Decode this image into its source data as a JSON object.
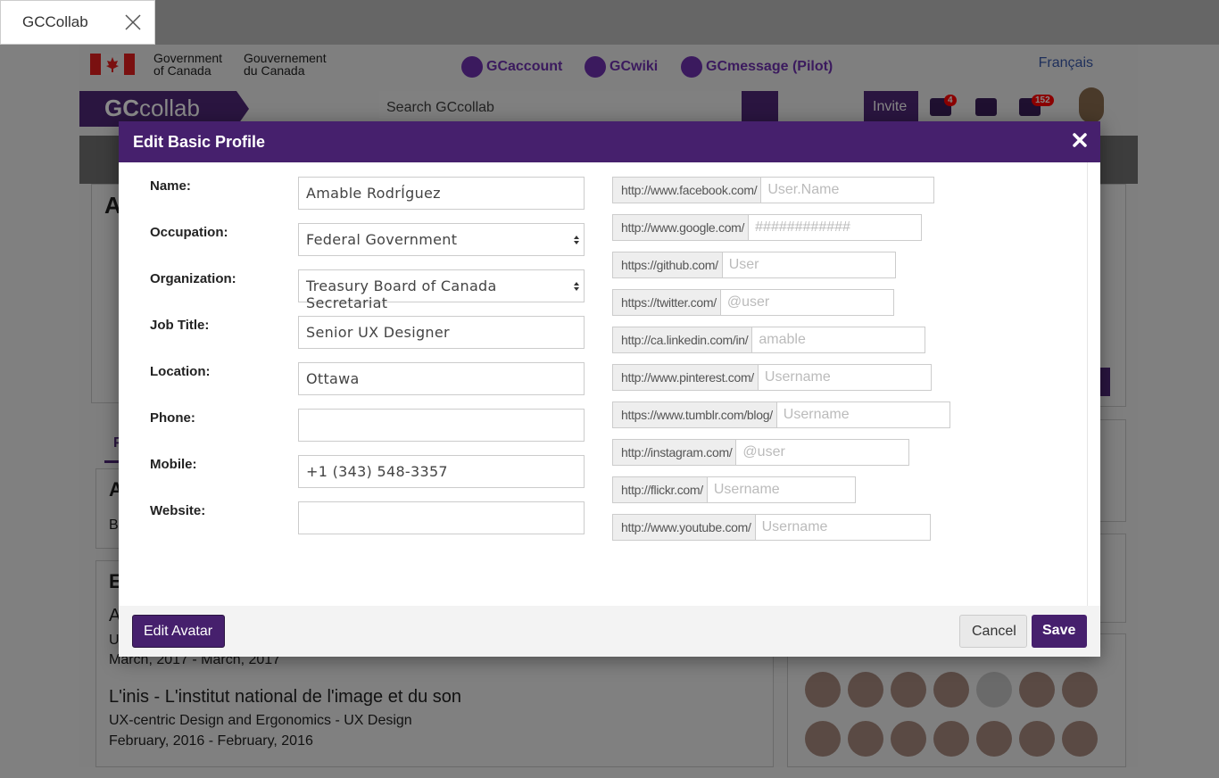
{
  "browser": {
    "tab_title": "GCCollab"
  },
  "header": {
    "gov_en_line1": "Government",
    "gov_en_line2": "of Canada",
    "gov_fr_line1": "Gouvernement",
    "gov_fr_line2": "du Canada",
    "tools": [
      "GCaccount",
      "GCwiki",
      "GCmessage (Pilot)"
    ],
    "language": "Français"
  },
  "navbar": {
    "brand_gc": "GC",
    "brand_rest": "collab",
    "search_placeholder": "Search GCcollab",
    "invite_label": "Invite",
    "colleague_badge": "4",
    "notification_badge": "152"
  },
  "background": {
    "edu_title": "L'inis - L'institut national de l'image et du son",
    "edu_program": "UX-centric Design and Ergonomics - UX Design",
    "edu_dates": "February, 2016 - February, 2016",
    "prev_dates": "March, 2017 - March, 2017",
    "frag_a": "A",
    "frag_u": "U",
    "frag_b": "B",
    "frag_e": "E",
    "frag_a2": "A",
    "frag_p": "P"
  },
  "modal": {
    "title": "Edit Basic Profile",
    "fields": [
      {
        "label": "Name:",
        "value": "Amable RodrÍguez",
        "type": "text"
      },
      {
        "label": "Occupation:",
        "value": "Federal Government",
        "type": "select"
      },
      {
        "label": "Organization:",
        "value": "Treasury Board of Canada Secretariat",
        "type": "select"
      },
      {
        "label": "Job Title:",
        "value": "Senior UX Designer",
        "type": "text"
      },
      {
        "label": "Location:",
        "value": "Ottawa",
        "type": "text"
      },
      {
        "label": "Phone:",
        "value": "",
        "type": "text"
      },
      {
        "label": "Mobile:",
        "value": "+1 (343) 548-3357",
        "type": "text"
      },
      {
        "label": "Website:",
        "value": "",
        "type": "text"
      }
    ],
    "social": [
      {
        "prefix": "http://www.facebook.com/",
        "placeholder": "User.Name"
      },
      {
        "prefix": "http://www.google.com/",
        "placeholder": "############"
      },
      {
        "prefix": "https://github.com/",
        "placeholder": "User"
      },
      {
        "prefix": "https://twitter.com/",
        "placeholder": "@user"
      },
      {
        "prefix": "http://ca.linkedin.com/in/",
        "placeholder": "amable"
      },
      {
        "prefix": "http://www.pinterest.com/",
        "placeholder": "Username"
      },
      {
        "prefix": "https://www.tumblr.com/blog/",
        "placeholder": "Username"
      },
      {
        "prefix": "http://instagram.com/",
        "placeholder": "@user"
      },
      {
        "prefix": "http://flickr.com/",
        "placeholder": "Username"
      },
      {
        "prefix": "http://www.youtube.com/",
        "placeholder": "Username"
      }
    ],
    "edit_avatar_label": "Edit Avatar",
    "cancel_label": "Cancel",
    "save_label": "Save"
  },
  "colors": {
    "brand_purple": "#46206d",
    "dark_purple": "#2a1540",
    "badge_red": "#c00000"
  }
}
